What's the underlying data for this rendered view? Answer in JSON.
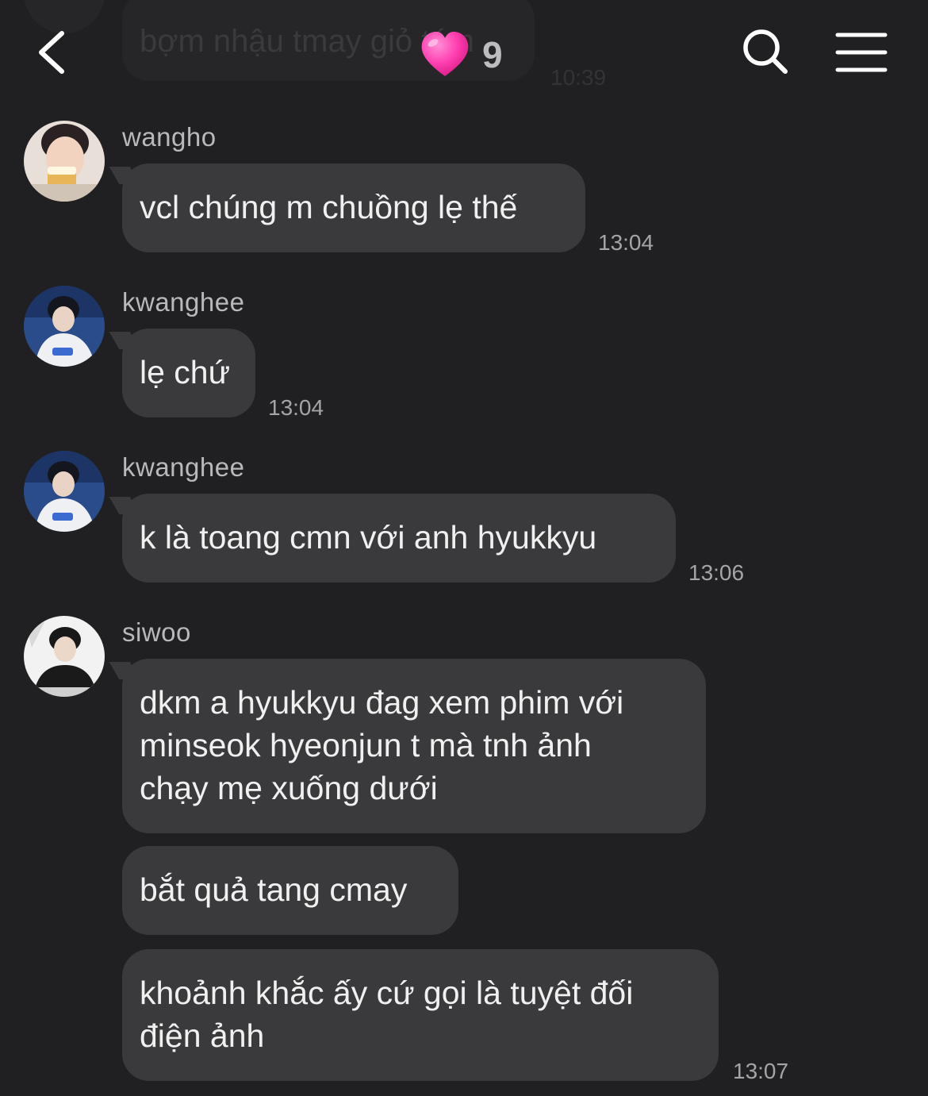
{
  "header": {
    "back_icon": "chevron-left-icon",
    "heart_icon": "pink-heart-icon",
    "member_count": "9",
    "search_icon": "search-icon",
    "menu_icon": "hamburger-menu-icon"
  },
  "previous_message": {
    "text": "bợm nhậu tmay giỏ tém",
    "time": "10:39"
  },
  "messages": [
    {
      "sender": "wangho",
      "bubbles": [
        "vcl chúng m chuồng lẹ thế"
      ],
      "time": "13:04"
    },
    {
      "sender": "kwanghee",
      "bubbles": [
        "lẹ chứ"
      ],
      "time": "13:04"
    },
    {
      "sender": "kwanghee",
      "bubbles": [
        "k là toang cmn với anh hyukkyu"
      ],
      "time": "13:06"
    },
    {
      "sender": "siwoo",
      "bubbles": [
        "dkm a hyukkyu đag xem phim với\nminseok hyeonjun t mà tnh ảnh\nchạy mẹ xuống dưới",
        "bắt quả tang cmay",
        "khoảnh khắc ấy cứ gọi là tuyệt đối\nđiện ảnh"
      ],
      "time": "13:07"
    }
  ],
  "colors": {
    "background": "#202022",
    "bubble": "#3a3a3c",
    "heart": "#ff3fb0"
  }
}
